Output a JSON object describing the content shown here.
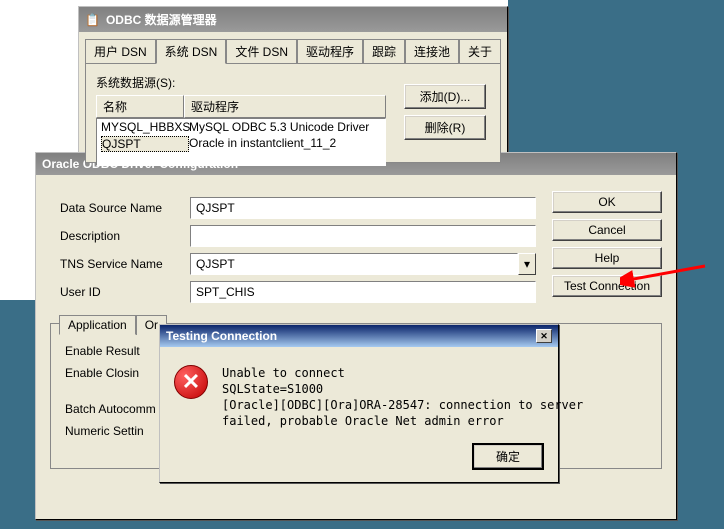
{
  "odbc_admin": {
    "title": "ODBC 数据源管理器",
    "tabs": [
      "用户 DSN",
      "系统 DSN",
      "文件 DSN",
      "驱动程序",
      "跟踪",
      "连接池",
      "关于"
    ],
    "active_tab": 1,
    "group_label": "系统数据源(S):",
    "columns": {
      "name": "名称",
      "driver": "驱动程序"
    },
    "rows": [
      {
        "name": "MYSQL_HBBXS",
        "driver": "MySQL ODBC 5.3 Unicode Driver"
      },
      {
        "name": "QJSPT",
        "driver": "Oracle in instantclient_11_2"
      }
    ],
    "buttons": {
      "add": "添加(D)...",
      "remove": "删除(R)"
    }
  },
  "oracle_cfg": {
    "title": "Oracle ODBC Driver Configuration",
    "fields": {
      "dsn_label": "Data Source Name",
      "dsn_value": "QJSPT",
      "desc_label": "Description",
      "desc_value": "",
      "tns_label": "TNS Service Name",
      "tns_value": "QJSPT",
      "user_label": "User ID",
      "user_value": "SPT_CHIS"
    },
    "buttons": {
      "ok": "OK",
      "cancel": "Cancel",
      "help": "Help",
      "test": "Test Connection"
    },
    "subtabs": [
      "Application",
      "Or"
    ],
    "options": {
      "enable_result": "Enable Result",
      "enable_closing": "Enable Closin",
      "batch_autocomm": "Batch Autocomm",
      "numeric_setting": "Numeric Settin"
    }
  },
  "error_dlg": {
    "title": "Testing Connection",
    "lines": {
      "l1": "Unable to connect",
      "l2": "SQLState=S1000",
      "l3": "[Oracle][ODBC][Ora]ORA-28547: connection to server",
      "l4": "failed, probable Oracle Net admin error"
    },
    "ok": "确定"
  }
}
